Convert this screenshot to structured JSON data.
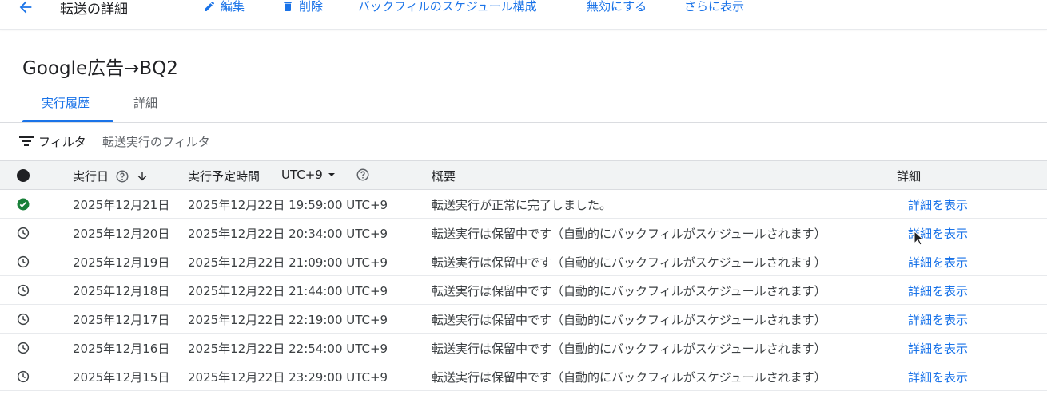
{
  "topbar": {
    "title": "転送の詳細",
    "actions": {
      "edit": "編集",
      "delete": "削除",
      "backfill": "バックフィルのスケジュール構成",
      "disable": "無効にする",
      "more": "さらに表示"
    }
  },
  "transfer": {
    "name": "Google広告→BQ2"
  },
  "tabs": {
    "history": "実行履歴",
    "details": "詳細"
  },
  "filter": {
    "label": "フィルタ",
    "placeholder": "転送実行のフィルタ"
  },
  "table": {
    "headers": {
      "run_date": "実行日",
      "scheduled_time": "実行予定時間",
      "timezone": "UTC+9",
      "summary": "概要",
      "details": "詳細"
    },
    "rows": [
      {
        "status": "success",
        "run_date": "2025年12月21日",
        "scheduled": "2025年12月22日 19:59:00 UTC+9",
        "summary": "転送実行が正常に完了しました。",
        "link": "詳細を表示"
      },
      {
        "status": "pending",
        "run_date": "2025年12月20日",
        "scheduled": "2025年12月22日 20:34:00 UTC+9",
        "summary": "転送実行は保留中です（自動的にバックフィルがスケジュールされます）",
        "link": "詳細を表示"
      },
      {
        "status": "pending",
        "run_date": "2025年12月19日",
        "scheduled": "2025年12月22日 21:09:00 UTC+9",
        "summary": "転送実行は保留中です（自動的にバックフィルがスケジュールされます）",
        "link": "詳細を表示"
      },
      {
        "status": "pending",
        "run_date": "2025年12月18日",
        "scheduled": "2025年12月22日 21:44:00 UTC+9",
        "summary": "転送実行は保留中です（自動的にバックフィルがスケジュールされます）",
        "link": "詳細を表示"
      },
      {
        "status": "pending",
        "run_date": "2025年12月17日",
        "scheduled": "2025年12月22日 22:19:00 UTC+9",
        "summary": "転送実行は保留中です（自動的にバックフィルがスケジュールされます）",
        "link": "詳細を表示"
      },
      {
        "status": "pending",
        "run_date": "2025年12月16日",
        "scheduled": "2025年12月22日 22:54:00 UTC+9",
        "summary": "転送実行は保留中です（自動的にバックフィルがスケジュールされます）",
        "link": "詳細を表示"
      },
      {
        "status": "pending",
        "run_date": "2025年12月15日",
        "scheduled": "2025年12月22日 23:29:00 UTC+9",
        "summary": "転送実行は保留中です（自動的にバックフィルがスケジュールされます）",
        "link": "詳細を表示"
      }
    ]
  },
  "colors": {
    "accent": "#1a73e8",
    "success": "#188038",
    "text": "#202124",
    "muted": "#5f6368"
  }
}
